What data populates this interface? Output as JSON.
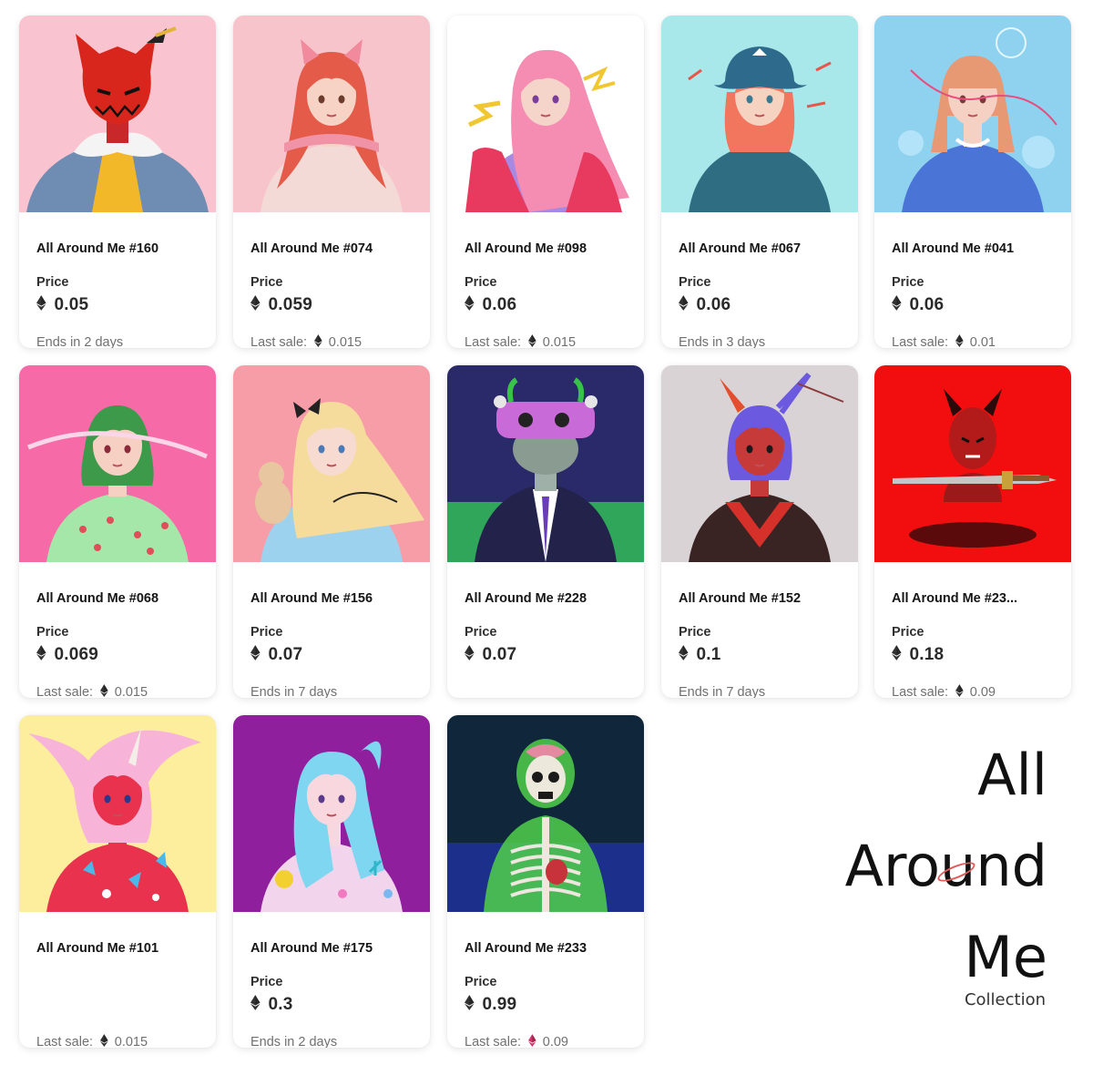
{
  "grid": {
    "price_label": "Price",
    "last_sale_label": "Last sale:",
    "cards": [
      {
        "title": "All Around Me #160",
        "price": "0.05",
        "footer_type": "ends",
        "footer": "Ends in 2 days",
        "art": "red-devil-jacket"
      },
      {
        "title": "All Around Me #074",
        "price": "0.059",
        "footer_type": "sale",
        "footer": "0.015",
        "art": "cat-ear-girl"
      },
      {
        "title": "All Around Me #098",
        "price": "0.06",
        "footer_type": "sale",
        "footer": "0.015",
        "art": "pink-hair-girl"
      },
      {
        "title": "All Around Me #067",
        "price": "0.06",
        "footer_type": "ends",
        "footer": "Ends in 3 days",
        "art": "blue-hat-girl"
      },
      {
        "title": "All Around Me #041",
        "price": "0.06",
        "footer_type": "sale",
        "footer": "0.01",
        "art": "bubble-girl"
      },
      {
        "title": "All Around Me #068",
        "price": "0.069",
        "footer_type": "sale",
        "footer": "0.015",
        "art": "green-hair-girl"
      },
      {
        "title": "All Around Me #156",
        "price": "0.07",
        "footer_type": "ends",
        "footer": "Ends in 7 days",
        "art": "blonde-teddy-girl"
      },
      {
        "title": "All Around Me #228",
        "price": "0.07",
        "footer_type": "none",
        "footer": "",
        "art": "monster-suit"
      },
      {
        "title": "All Around Me #152",
        "price": "0.1",
        "footer_type": "ends",
        "footer": "Ends in 7 days",
        "art": "horned-sailor"
      },
      {
        "title": "All Around Me #23...",
        "price": "0.18",
        "footer_type": "sale",
        "footer": "0.09",
        "art": "red-demon-dagger"
      },
      {
        "title": "All Around Me #101",
        "price": "",
        "footer_type": "sale",
        "footer": "0.015",
        "art": "pink-unicorn-girl"
      },
      {
        "title": "All Around Me #175",
        "price": "0.3",
        "footer_type": "ends",
        "footer": "Ends in 2 days",
        "art": "pastel-twin-tails"
      },
      {
        "title": "All Around Me #233",
        "price": "0.99",
        "footer_type": "sale",
        "footer": "0.09",
        "footer_eth_color": "#d6336c",
        "art": "anatomy-skeleton"
      }
    ]
  },
  "brand": {
    "line1": "All",
    "line2": "Around",
    "line3": "Me",
    "subtitle": "Collection"
  },
  "colors": {
    "eth_icon": "#333333",
    "eth_icon_pink": "#d6336c",
    "card_bg": "#ffffff",
    "muted_text": "#707070"
  }
}
